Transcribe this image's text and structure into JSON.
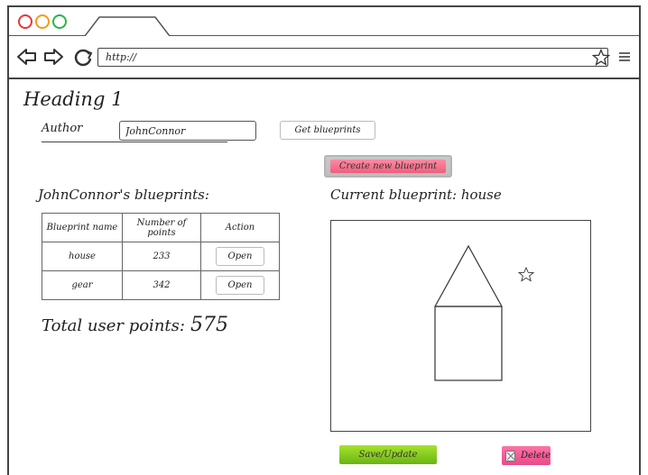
{
  "browser": {
    "url": "http://"
  },
  "page": {
    "heading": "Heading 1",
    "author_label": "Author",
    "author_value": "JohnConnor",
    "get_blueprints_label": "Get blueprints",
    "create_blueprint_label": "Create new blueprint",
    "blueprints_title": "JohnConnor's blueprints:",
    "current_blueprint_title": "Current blueprint: house",
    "table": {
      "headers": [
        "Blueprint name",
        "Number of points",
        "Action"
      ],
      "rows": [
        {
          "name": "house",
          "points": "233",
          "action": "Open"
        },
        {
          "name": "gear",
          "points": "342",
          "action": "Open"
        }
      ]
    },
    "total_label": "Total user points:",
    "total_value": "575",
    "save_label": "Save/Update",
    "delete_label": "Delete"
  },
  "colors": {
    "create_button": "#ee5f7d",
    "save_button": "#7cc21a",
    "delete_button": "#ee5a94",
    "close_dot": "#e53935",
    "minimize_dot": "#f39c12",
    "maximize_dot": "#2db34a"
  },
  "icons": [
    "back-arrow-icon",
    "forward-arrow-icon",
    "reload-icon",
    "bookmark-star-icon",
    "hamburger-menu-icon",
    "delete-icon"
  ]
}
